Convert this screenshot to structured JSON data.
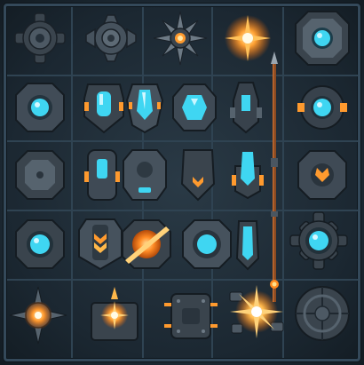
{
  "sheet": {
    "background": "#1b2731",
    "frame_color": "#34495a",
    "accent_cyan": "#3fd6f2",
    "accent_orange": "#ff9a2e",
    "metal_dark": "#3a444d",
    "metal_light": "#6d7a85"
  },
  "rows": [
    [
      "gear-emblem-dark",
      "gear-emblem-cross",
      "spiked-star-core",
      "burning-star-glow",
      null,
      "octagon-cyan-gem-badge"
    ],
    [
      "octagon-cyan-gem",
      "shield-cyan-vertical",
      "shield-cyan-crest",
      "octagon-cyan-faceted",
      "bolt-cyan-slot",
      "round-cyan-gem-amber"
    ],
    [
      "octagon-plain-plate",
      "shield-cyan-bar",
      "shield-cyan-lower-slot",
      "shield-chevron-amber",
      "shield-cyan-tall",
      "octagon-amber-rune"
    ],
    [
      "octagon-cyan-round",
      "shield-amber-chevron",
      "flaming-orb-slash",
      "octagon-cyan-ring",
      "capsule-cyan-slim",
      "gear-cyan-core-large"
    ],
    [
      "spiked-sun-compass",
      "flame-torch-star",
      "riveted-box-plate",
      "mechanical-explosion",
      null,
      "segmented-disc-plate"
    ]
  ],
  "rod": {
    "icon": "spear-staff-icon"
  }
}
